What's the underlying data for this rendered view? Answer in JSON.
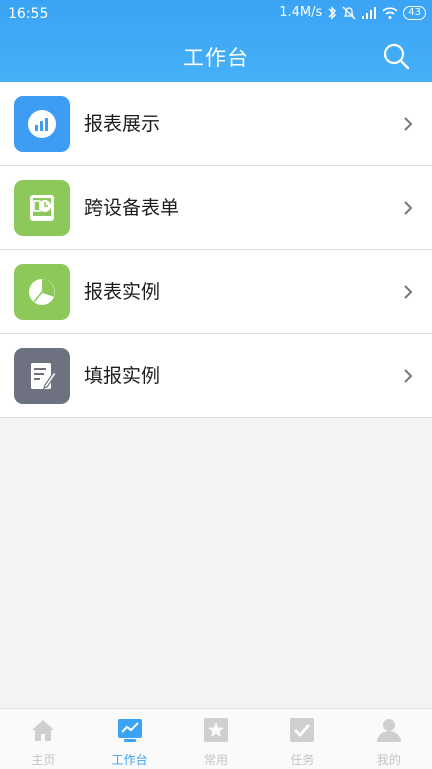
{
  "status": {
    "time": "16:55",
    "network_speed": "1.4M/s",
    "battery": "43"
  },
  "header": {
    "title": "工作台"
  },
  "menu": [
    {
      "label": "报表展示",
      "icon": "report-chart-icon",
      "color": "#3d9df5"
    },
    {
      "label": "跨设备表单",
      "icon": "device-clock-icon",
      "color": "#8cc95a"
    },
    {
      "label": "报表实例",
      "icon": "pie-chart-icon",
      "color": "#8cc95a"
    },
    {
      "label": "填报实例",
      "icon": "edit-document-icon",
      "color": "#6e7280"
    }
  ],
  "tabs": [
    {
      "label": "主页",
      "icon": "home-icon",
      "active": false
    },
    {
      "label": "工作台",
      "icon": "workbench-icon",
      "active": true
    },
    {
      "label": "常用",
      "icon": "star-icon",
      "active": false
    },
    {
      "label": "任务",
      "icon": "task-check-icon",
      "active": false
    },
    {
      "label": "我的",
      "icon": "profile-icon",
      "active": false
    }
  ],
  "colors": {
    "primary": "#3aa3f5",
    "tab_inactive": "#c4c4c4"
  }
}
